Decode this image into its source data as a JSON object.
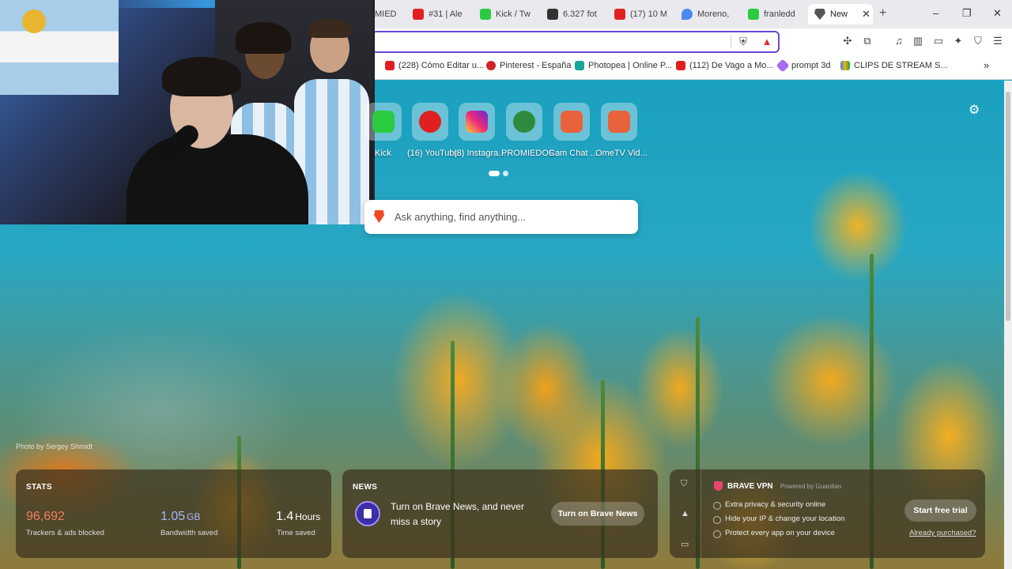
{
  "colors": {
    "accent_purple": "#6b48d6",
    "brave_orange": "#f04a24",
    "stats_orange": "#f87c5c",
    "bandwidth_blue": "#a7b6ff"
  },
  "tabs": [
    {
      "label": "MIED",
      "icon": "tab-icon",
      "color": "#888"
    },
    {
      "label": "#31 | Ale",
      "icon": "youtube-icon",
      "color": "#e02020"
    },
    {
      "label": "Kick / Tw",
      "icon": "kick-icon",
      "color": "#2acb40"
    },
    {
      "label": "6.327 fot",
      "icon": "photo-site-icon",
      "color": "#333"
    },
    {
      "label": "(17) 10 M",
      "icon": "youtube-icon",
      "color": "#e02020"
    },
    {
      "label": "Moreno, ",
      "icon": "maps-icon",
      "color": "#4d8af0"
    },
    {
      "label": "franledd",
      "icon": "kick-icon",
      "color": "#2acb40"
    },
    {
      "label": "New",
      "icon": "brave-icon",
      "color": "#555"
    }
  ],
  "window": {
    "new_tab": "+",
    "minimize": "–",
    "restore": "❐",
    "close": "✕"
  },
  "bookmarks": [
    {
      "label": "(228) Cómo Editar u...",
      "color": "#e02020"
    },
    {
      "label": "Pinterest - España",
      "color": "#d2232a"
    },
    {
      "label": "Photopea | Online P...",
      "color": "#18a497"
    },
    {
      "label": "(112) De Vago a Mo...",
      "color": "#e02020"
    },
    {
      "label": "prompt 3d",
      "color": "#a66cf0"
    },
    {
      "label": "CLIPS DE STREAM S...",
      "color": "#f4b400"
    }
  ],
  "bookmarks_more": "»",
  "shortcuts": [
    {
      "label": "Kick",
      "color": "#2acb40"
    },
    {
      "label": "(16) YouTube",
      "color": "#e02020"
    },
    {
      "label": "(3) Instagra...",
      "color": "#d6249f"
    },
    {
      "label": "PROMIEDOS",
      "color": "#2e8b3e"
    },
    {
      "label": "Cam Chat ...",
      "color": "#e8633c"
    },
    {
      "label": "OmeTV Vid...",
      "color": "#e8633c"
    }
  ],
  "search": {
    "placeholder": "Ask anything, find anything..."
  },
  "photo_credit": "Photo by Sergey Shmidt",
  "stats": {
    "title": "STATS",
    "trackers": {
      "value": "96,692",
      "label": "Trackers & ads blocked"
    },
    "bandwidth": {
      "value": "1.05",
      "unit": "GB",
      "label": "Bandwidth saved"
    },
    "time": {
      "value": "1.4",
      "unit": "Hours",
      "label": "Time saved"
    }
  },
  "news": {
    "title": "NEWS",
    "text": "Turn on Brave News, and never miss a story",
    "button": "Turn on Brave News"
  },
  "vpn": {
    "title": "BRAVE VPN",
    "powered": "Powered by",
    "powered_brand": "Guardian",
    "features": [
      "Extra privacy & security online",
      "Hide your IP & change your location",
      "Protect every app on your device"
    ],
    "button": "Start free trial",
    "link": "Already purchased?"
  }
}
